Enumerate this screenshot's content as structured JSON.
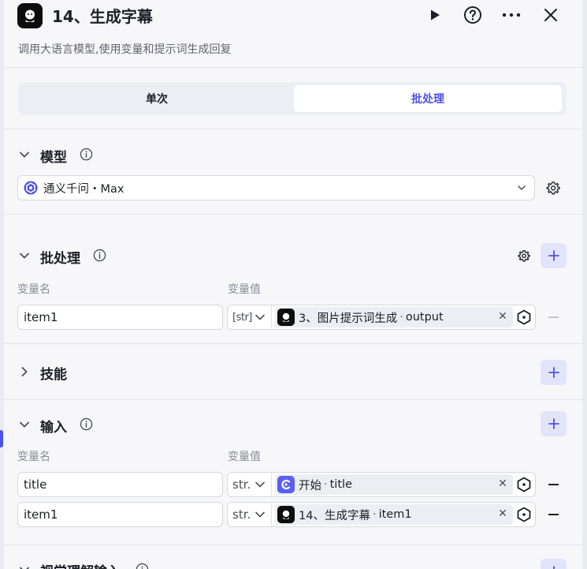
{
  "header": {
    "title": "14、生成字幕",
    "description": "调用大语言模型,使用变量和提示词生成回复",
    "icons": [
      "play-icon",
      "help-icon",
      "more-icon",
      "close-icon"
    ]
  },
  "tabs": [
    {
      "label": "单次",
      "active": false
    },
    {
      "label": "批处理",
      "active": true
    }
  ],
  "model_section": {
    "title": "模型",
    "selected_model": "通义千问・Max"
  },
  "batch_section": {
    "title": "批处理",
    "col_name": "变量名",
    "col_value": "变量值",
    "rows": [
      {
        "name": "item1",
        "type": "[str]",
        "ref_node": "3、图片提示词生成",
        "ref_var": "output"
      }
    ]
  },
  "skills_section": {
    "title": "技能"
  },
  "input_section": {
    "title": "输入",
    "col_name": "变量名",
    "col_value": "变量值",
    "rows": [
      {
        "name": "title",
        "type": "str.",
        "ref_node": "开始",
        "ref_var": "title"
      },
      {
        "name": "item1",
        "type": "str.",
        "ref_node": "14、生成字幕",
        "ref_var": "item1"
      }
    ]
  },
  "next_section": {
    "title": "视觉理解输入"
  },
  "colors": {
    "accent": "#4d53e8",
    "accent_bg": "#e2e4fb",
    "panel_bg": "#f7f7fa"
  }
}
